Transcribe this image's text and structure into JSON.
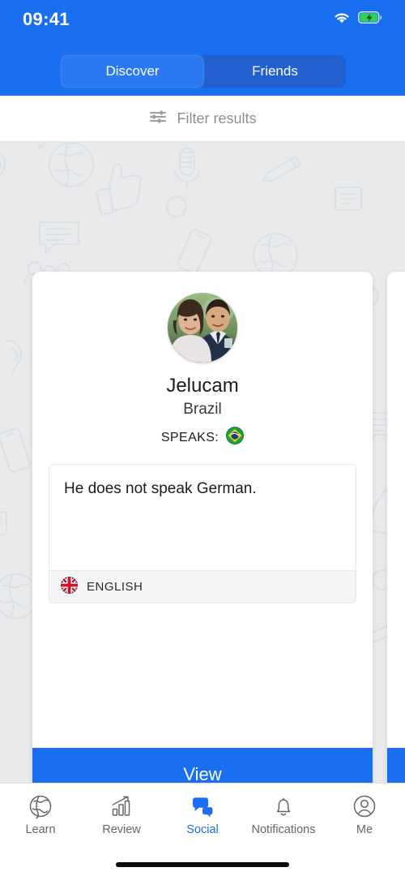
{
  "status_bar": {
    "time": "09:41",
    "wifi_icon": "wifi-icon",
    "battery_icon": "battery-charging-icon"
  },
  "header": {
    "accent_color": "#1a6ef0",
    "tabs": [
      {
        "label": "Discover",
        "active": true
      },
      {
        "label": "Friends",
        "active": false
      }
    ]
  },
  "filter": {
    "icon": "filter-sliders-icon",
    "label": "Filter results"
  },
  "card": {
    "avatar_alt": "user-avatar-photo",
    "name": "Jelucam",
    "country": "Brazil",
    "speaks_label": "SPEAKS:",
    "speaks_flag": "brazil-flag-icon",
    "message": "He does not speak German.",
    "message_language_flag": "uk-flag-icon",
    "message_language": "ENGLISH",
    "action_label": "View"
  },
  "tab_bar": {
    "active_color": "#1a6ef0",
    "inactive_color": "#62676d",
    "items": [
      {
        "label": "Learn",
        "icon": "globe-icon",
        "active": false
      },
      {
        "label": "Review",
        "icon": "bar-chart-arrow-icon",
        "active": false
      },
      {
        "label": "Social",
        "icon": "chat-bubbles-icon",
        "active": true
      },
      {
        "label": "Notifications",
        "icon": "bell-icon",
        "active": false
      },
      {
        "label": "Me",
        "icon": "person-circle-icon",
        "active": false
      }
    ]
  }
}
